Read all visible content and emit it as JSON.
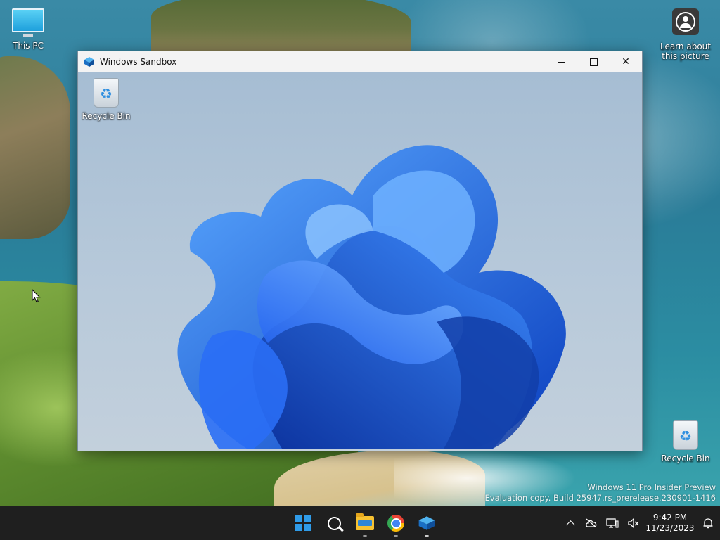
{
  "desktop": {
    "icons": {
      "this_pc": "This PC",
      "learn_line1": "Learn about",
      "learn_line2": "this picture",
      "recycle_bin": "Recycle Bin"
    },
    "watermark": {
      "line1": "Windows 11 Pro Insider Preview",
      "line2": "Evaluation copy. Build 25947.rs_prerelease.230901-1416"
    }
  },
  "window": {
    "title": "Windows Sandbox",
    "controls": {
      "minimize": "minimize",
      "maximize": "maximize",
      "close": "✕"
    },
    "desktop_icons": {
      "recycle_bin": "Recycle Bin"
    }
  },
  "taskbar": {
    "pinned": [
      "start-button",
      "search-button",
      "file-explorer",
      "chrome",
      "windows-sandbox"
    ],
    "running": [
      "file-explorer",
      "chrome",
      "windows-sandbox"
    ],
    "tray": {
      "time": "9:42 PM",
      "date": "11/23/2023",
      "icons": [
        "chevron-up-icon",
        "cloud-off-icon",
        "network-icon",
        "volume-mute-icon",
        "notification-bell-icon"
      ]
    }
  },
  "colors": {
    "taskbar_bg": "#1f1f1f",
    "start_blue": "#2f9be8",
    "bloom_blue": "#1a5fe0",
    "titlebar_bg": "#f3f3f3"
  }
}
